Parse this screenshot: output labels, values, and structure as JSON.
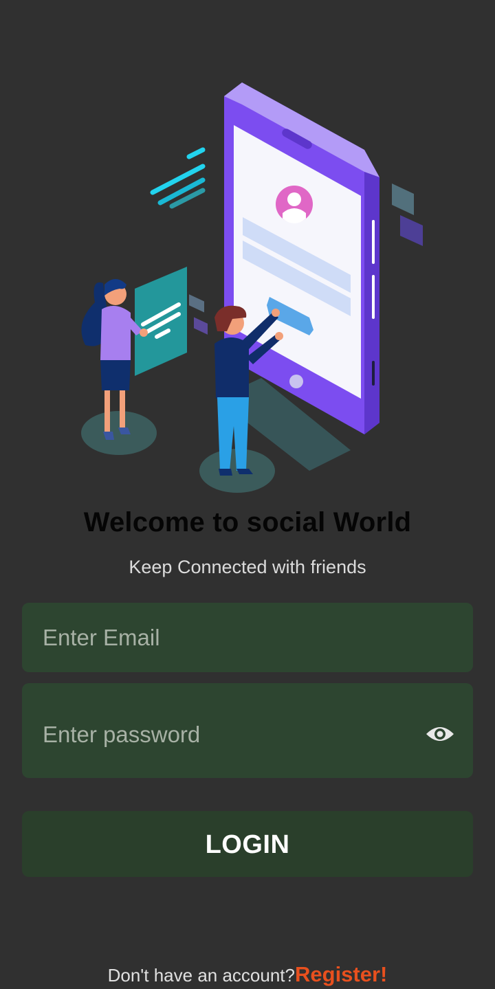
{
  "hero": {
    "illustration": "phone-login-illustration"
  },
  "welcome": {
    "title": "Welcome to social World",
    "subtitle": "Keep Connected with friends"
  },
  "form": {
    "email_placeholder": "Enter Email",
    "email_value": "",
    "password_placeholder": "Enter password",
    "password_value": "",
    "visibility_icon": "eye-icon",
    "login_label": "LOGIN"
  },
  "footer": {
    "prompt": "Don't have an account?",
    "register_label": "Register!"
  },
  "colors": {
    "background": "#303030",
    "field_background": "#2d4530",
    "button_background": "#2a3f2b",
    "register_accent": "#e8501e"
  }
}
